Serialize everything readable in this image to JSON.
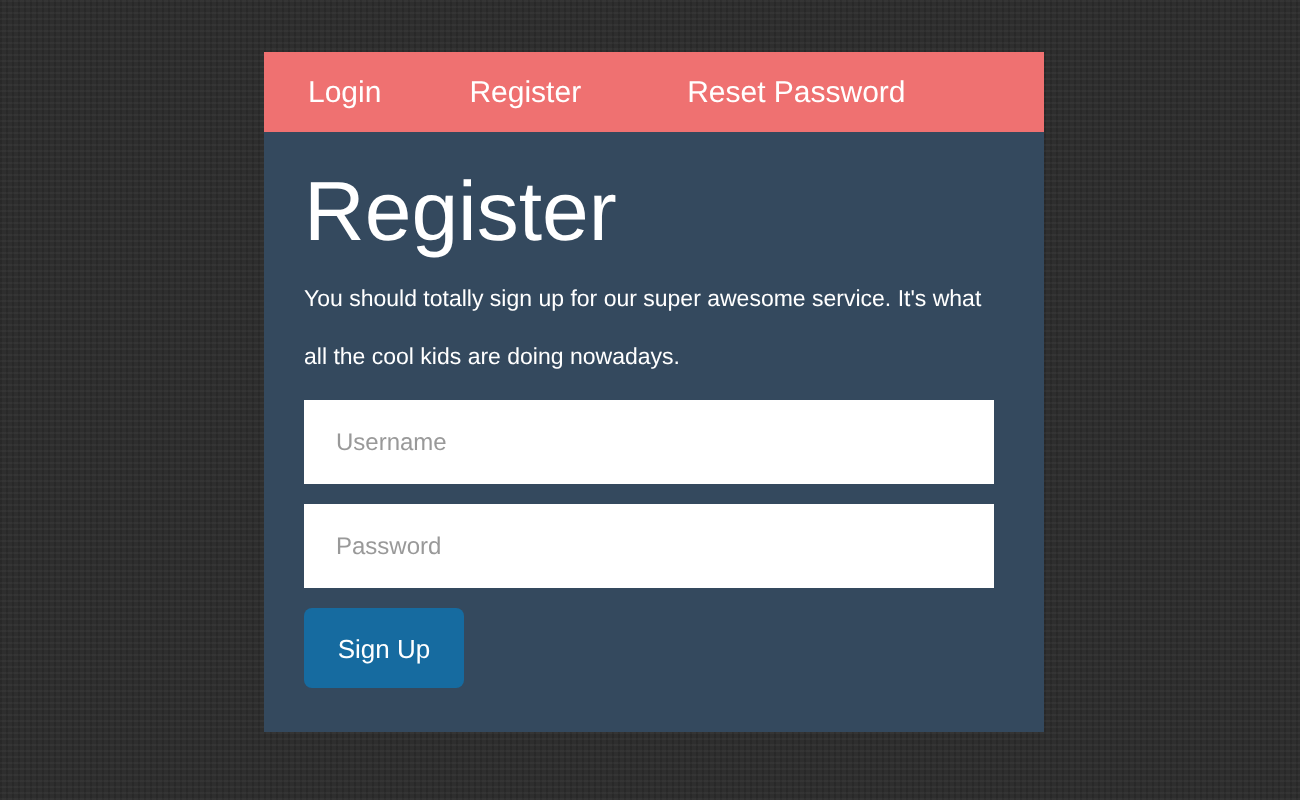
{
  "tabs": [
    {
      "label": "Login"
    },
    {
      "label": "Register"
    },
    {
      "label": "Reset Password"
    }
  ],
  "heading": "Register",
  "description": "You should totally sign up for our super awesome service. It's what all the cool kids are doing nowadays.",
  "fields": [
    {
      "placeholder": "Username"
    },
    {
      "placeholder": "Password"
    }
  ],
  "submit": "Sign Up"
}
